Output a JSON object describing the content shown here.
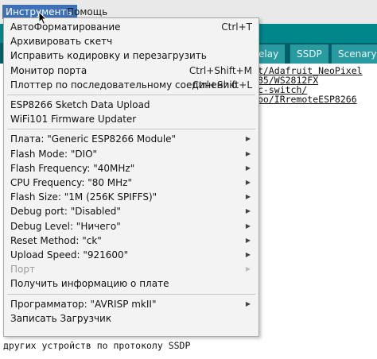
{
  "menubar": {
    "items": [
      "Инструменты",
      "Помощь"
    ],
    "active": "Инструменты"
  },
  "tabs": [
    "elay",
    "SSDP",
    "Scenary"
  ],
  "code_lines": [
    "t/Adafruit_NeoPixel",
    "85/WS2812FX",
    "c-switch/",
    "bo/IRremoteESP8266"
  ],
  "bottom_line": "других устройств по протоколу SSDP",
  "menu": [
    {
      "label": "АвтоФорматирование",
      "shortcut": "Ctrl+T"
    },
    {
      "label": "Архивировать скетч"
    },
    {
      "label": "Исправить кодировку и перезагрузить"
    },
    {
      "label": "Монитор порта",
      "shortcut": "Ctrl+Shift+M"
    },
    {
      "label": "Плоттер по последовательному соединению",
      "shortcut": "Ctrl+Shift+L"
    },
    {
      "separator": true
    },
    {
      "label": "ESP8266 Sketch Data Upload"
    },
    {
      "label": "WiFi101 Firmware Updater"
    },
    {
      "separator": true
    },
    {
      "label": "Плата: \"Generic ESP8266 Module\"",
      "submenu": true
    },
    {
      "label": "Flash Mode: \"DIO\"",
      "submenu": true
    },
    {
      "label": "Flash Frequency: \"40MHz\"",
      "submenu": true
    },
    {
      "label": "CPU Frequency: \"80 MHz\"",
      "submenu": true
    },
    {
      "label": "Flash Size: \"1M (256K SPIFFS)\"",
      "submenu": true
    },
    {
      "label": "Debug port: \"Disabled\"",
      "submenu": true
    },
    {
      "label": "Debug Level: \"Ничего\"",
      "submenu": true
    },
    {
      "label": "Reset Method: \"ck\"",
      "submenu": true
    },
    {
      "label": "Upload Speed: \"921600\"",
      "submenu": true
    },
    {
      "label": "Порт",
      "submenu": true,
      "disabled": true
    },
    {
      "label": "Получить информацию о плате"
    },
    {
      "separator": true
    },
    {
      "label": "Программатор: \"AVRISP mkII\"",
      "submenu": true
    },
    {
      "label": "Записать Загрузчик"
    }
  ],
  "colors": {
    "menu_highlight": "#3d72b9",
    "toolbar": "#00878a",
    "tabs_bg": "#00606a"
  },
  "icons": {
    "submenu": "submenu-arrow-icon",
    "cursor": "mouse-cursor-icon"
  }
}
